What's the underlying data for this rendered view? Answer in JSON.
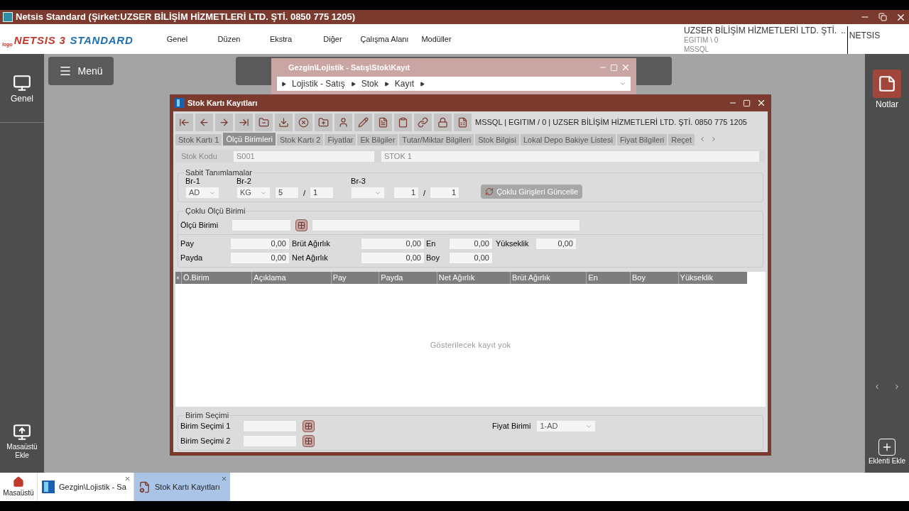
{
  "window": {
    "title": "Netsis Standard (Şirket:UZSER BİLİŞİM HİZMETLERİ LTD. ŞTİ. 0850 775 1205)"
  },
  "logo": {
    "prefix": "logo",
    "name": "NETSIS 3",
    "edition": "STANDARD"
  },
  "menu": [
    "Genel",
    "Düzen",
    "Ekstra",
    "Diğer",
    "Çalışma Alanı",
    "Modüller"
  ],
  "company": {
    "name": "UZSER BİLİŞİM HİZMETLERİ LTD. ŞTİ.",
    "more": "..",
    "database": "EGITIM \\ 0",
    "server": "MSSQL",
    "user": "NETSIS"
  },
  "left_sidebar": {
    "top": "Genel",
    "bottom": "Masaüstü Ekle"
  },
  "menu_button": "Menü",
  "right_sidebar": {
    "notes": "Notlar",
    "add": "Eklenti Ekle"
  },
  "explorer": {
    "title": "Gezgin\\Lojistik - Satış\\Stok\\Kayıt",
    "path": [
      "Lojistik - Satış",
      "Stok",
      "Kayıt"
    ]
  },
  "form": {
    "title": "Stok Kartı Kayıtları",
    "info": "MSSQL | EGITIM / 0 | UZSER BİLİŞİM HİZMETLERİ LTD. ŞTİ. 0850 775 1205",
    "tabs": [
      {
        "label": "Stok Kartı 1",
        "selected": false
      },
      {
        "label": "Ölçü Birimleri",
        "selected": true
      },
      {
        "label": "Stok Kartı 2",
        "selected": false
      },
      {
        "label": "Fiyatlar",
        "selected": false
      },
      {
        "label": "Ek Bilgiler",
        "selected": false
      },
      {
        "label": "Tutar/Miktar Bilgileri",
        "selected": false
      },
      {
        "label": "Stok Bilgisi",
        "selected": false
      },
      {
        "label": "Lokal Depo Bakiye Listesi",
        "selected": false
      },
      {
        "label": "Fiyat Bilgileri",
        "selected": false
      },
      {
        "label": "Reçet",
        "selected": false
      }
    ],
    "stock_code": {
      "label": "Stok Kodu",
      "code": "S001",
      "name": "STOK 1"
    },
    "fixed": {
      "title": "Sabit Tanımlamalar",
      "br1": {
        "label": "Br-1",
        "value": "AD"
      },
      "br2": {
        "label": "Br-2",
        "value": "KG",
        "numerator": "5",
        "separator": "/",
        "denominator": "1"
      },
      "br3": {
        "label": "Br-3",
        "numerator": "1",
        "separator": "/",
        "denominator": "1"
      },
      "button": "Çoklu Girişleri Güncelle"
    },
    "multi": {
      "title": "Çoklu Ölçü Birimi",
      "unit_label": "Ölçü Birimi",
      "rows": [
        [
          {
            "label": "Pay",
            "value": "0,00"
          },
          {
            "label": "Brüt Ağırlık",
            "value": "0,00"
          },
          {
            "label": "En",
            "value": "0,00"
          },
          {
            "label": "Yükseklik",
            "value": "0,00"
          }
        ],
        [
          {
            "label": "Payda",
            "value": "0,00"
          },
          {
            "label": "Net Ağırlık",
            "value": "0,00"
          },
          {
            "label": "Boy",
            "value": "0,00"
          }
        ]
      ]
    },
    "grid": {
      "columns": [
        "Ö.Birim",
        "Açıklama",
        "Pay",
        "Payda",
        "Net Ağırlık",
        "Brüt Ağırlık",
        "En",
        "Boy",
        "Yükseklik"
      ],
      "empty": "Gösterilecek kayıt yok"
    },
    "unit_selection": {
      "title": "Birim Seçimi",
      "rows": [
        "Birim Seçimi 1",
        "Birim Seçimi 2"
      ],
      "price_unit": {
        "label": "Fiyat Birimi",
        "value": "1-AD"
      }
    }
  },
  "taskbar": [
    {
      "label": "Masaüstü",
      "kind": "home",
      "selected": false
    },
    {
      "label": "Gezgin\\Lojistik - Sa",
      "kind": "app",
      "selected": false
    },
    {
      "label": "Stok Kartı Kayıtları",
      "kind": "form",
      "selected": true
    }
  ]
}
